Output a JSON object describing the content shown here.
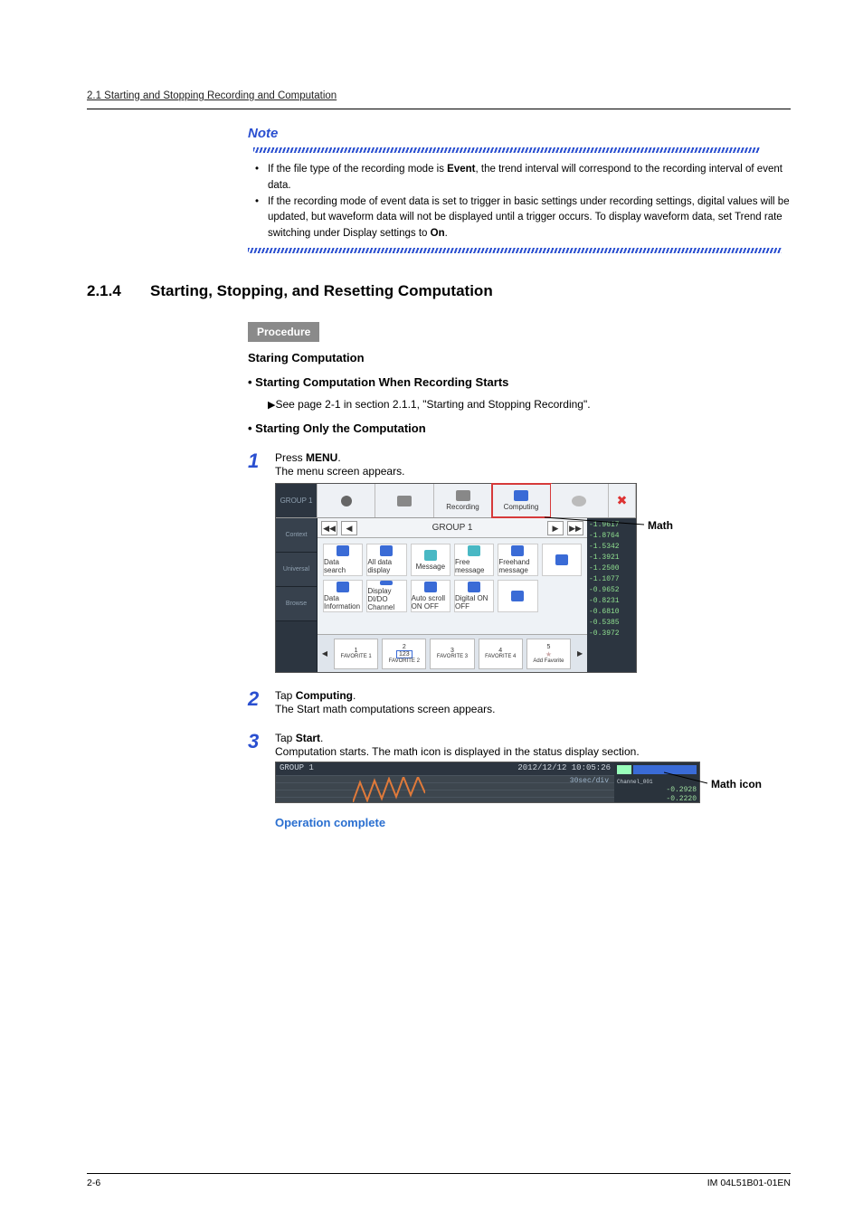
{
  "header": {
    "running_head": "2.1  Starting and Stopping Recording and Computation"
  },
  "note": {
    "title": "Note",
    "items": [
      "If the file type of the recording mode is <b>Event</b>, the trend interval will correspond to the recording interval of event data.",
      "If the recording mode of event data is set to trigger in basic settings under recording settings, digital values will be updated, but waveform data will not be displayed until a trigger occurs. To display waveform data, set Trend rate switching under Display settings to <b>On</b>."
    ]
  },
  "section": {
    "number": "2.1.4",
    "title": "Starting, Stopping, and Resetting Computation"
  },
  "procedure": {
    "badge": "Procedure",
    "subheading": "Staring Computation",
    "bullet1": "Starting Computation When Recording Starts",
    "see_ref": "See page 2-1 in section 2.1.1, \"Starting and Stopping Recording\".",
    "bullet2": "Starting Only the Computation"
  },
  "steps": {
    "s1": {
      "lead": "Press <b>MENU</b>.",
      "sub": "The menu screen appears."
    },
    "s2": {
      "lead": "Tap <b>Computing</b>.",
      "sub": "The Start math computations screen appears."
    },
    "s3": {
      "lead": "Tap <b>Start</b>.",
      "sub": "Computation starts. The math icon is displayed in the status display section."
    }
  },
  "screenshot1": {
    "side_group": "GROUP 1",
    "top": {
      "rec": "Recording",
      "comp": "Computing"
    },
    "side": {
      "context": "Context",
      "universal": "Universal",
      "browse": "Browse"
    },
    "group_bar": "GROUP 1",
    "grid_labels": [
      "Data search",
      "All data display",
      "Message",
      "Free message",
      "Freehand message",
      "",
      "Data Information",
      "Display DI/DO Channel",
      "Auto scroll ON OFF",
      "Digital ON OFF",
      ""
    ],
    "fav": [
      "FAVORITE 1",
      "FAVORITE 2",
      "FAVORITE 3",
      "FAVORITE 4",
      "Add Favorite"
    ],
    "fav_inner": [
      "",
      "123",
      "",
      "",
      ""
    ],
    "vals": [
      "-1.9617",
      "-1.8764",
      "-1.5342",
      "-1.3921",
      "-1.2500",
      "-1.1077",
      "-0.9652",
      "-0.8231",
      "-0.6810",
      "-0.5385",
      "-0.3972"
    ],
    "callout": "Math"
  },
  "screenshot2": {
    "group": "GROUP 1",
    "timestamp": "2012/12/12 10:05:26",
    "scale": "30sec/div",
    "ch": "Channel_001",
    "v1": "-0.2928",
    "v2": "-0.2220",
    "callout": "Math icon"
  },
  "op_complete": "Operation complete",
  "footer": {
    "left": "2-6",
    "right": "IM 04L51B01-01EN"
  }
}
